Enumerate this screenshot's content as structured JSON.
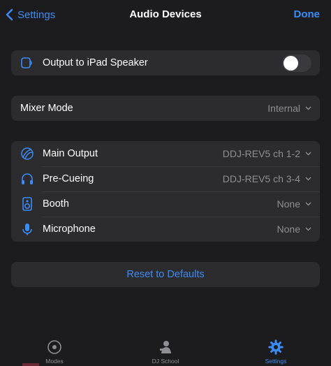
{
  "nav": {
    "back_label": "Settings",
    "title": "Audio Devices",
    "done_label": "Done"
  },
  "speaker": {
    "label": "Output to iPad Speaker",
    "toggle_on": false
  },
  "mixer": {
    "label": "Mixer Mode",
    "value": "Internal"
  },
  "devices": [
    {
      "icon": "main-output-icon",
      "label": "Main Output",
      "value": "DDJ-REV5 ch 1-2"
    },
    {
      "icon": "headphones-icon",
      "label": "Pre-Cueing",
      "value": "DDJ-REV5 ch 3-4"
    },
    {
      "icon": "speaker-icon",
      "label": "Booth",
      "value": "None"
    },
    {
      "icon": "microphone-icon",
      "label": "Microphone",
      "value": "None"
    }
  ],
  "reset_label": "Reset to Defaults",
  "tabs": [
    {
      "icon": "disc-icon",
      "label": "Modes",
      "active": false
    },
    {
      "icon": "dj-school-icon",
      "label": "DJ School",
      "active": false
    },
    {
      "icon": "gear-icon",
      "label": "Settings",
      "active": true
    }
  ],
  "colors": {
    "accent": "#3a8cf6",
    "background": "#1c1c1e",
    "cell": "#2c2c2e",
    "secondary_text": "#8e8e93"
  }
}
